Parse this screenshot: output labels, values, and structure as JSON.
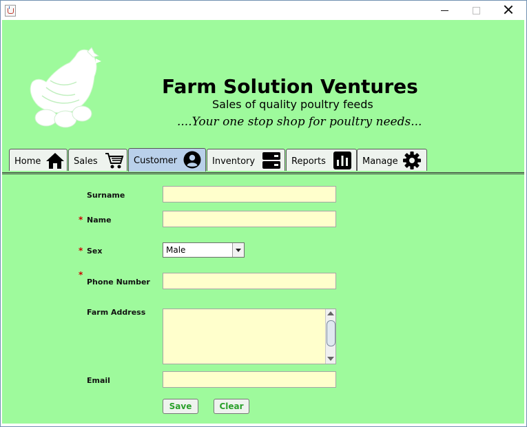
{
  "window": {
    "icons": {
      "app": "java-cup-icon",
      "minimize": "minimize-icon",
      "maximize": "maximize-icon",
      "close": "close-icon"
    }
  },
  "header": {
    "company_name": "Farm Solution Ventures",
    "tagline": "Sales of quality poultry feeds",
    "slogan": "....Your one stop shop for poultry needs...",
    "logo_icon": "hen-with-eggs-logo"
  },
  "tabs": [
    {
      "label": "Home",
      "icon": "home-icon",
      "selected": false
    },
    {
      "label": "Sales",
      "icon": "cart-icon",
      "selected": false
    },
    {
      "label": "Customer",
      "icon": "user-circle-icon",
      "selected": true
    },
    {
      "label": "Inventory",
      "icon": "storage-icon",
      "selected": false
    },
    {
      "label": "Reports",
      "icon": "bar-chart-icon",
      "selected": false
    },
    {
      "label": "Manage",
      "icon": "gear-icon",
      "selected": false
    }
  ],
  "form": {
    "required_marker": "*",
    "surname": {
      "label": "Surname",
      "value": ""
    },
    "name": {
      "label": "Name",
      "value": ""
    },
    "sex": {
      "label": "Sex",
      "value": "Male"
    },
    "phone": {
      "label": "Phone Number",
      "value": ""
    },
    "address": {
      "label": "Farm Address",
      "value": ""
    },
    "email": {
      "label": "Email",
      "value": ""
    },
    "save_label": "Save",
    "clear_label": "Clear"
  },
  "colors": {
    "background": "#9efa9c",
    "field": "#ffffcc",
    "selected_tab": "#b9d0ea",
    "required": "#d00000",
    "button_text": "#2aa02a"
  }
}
